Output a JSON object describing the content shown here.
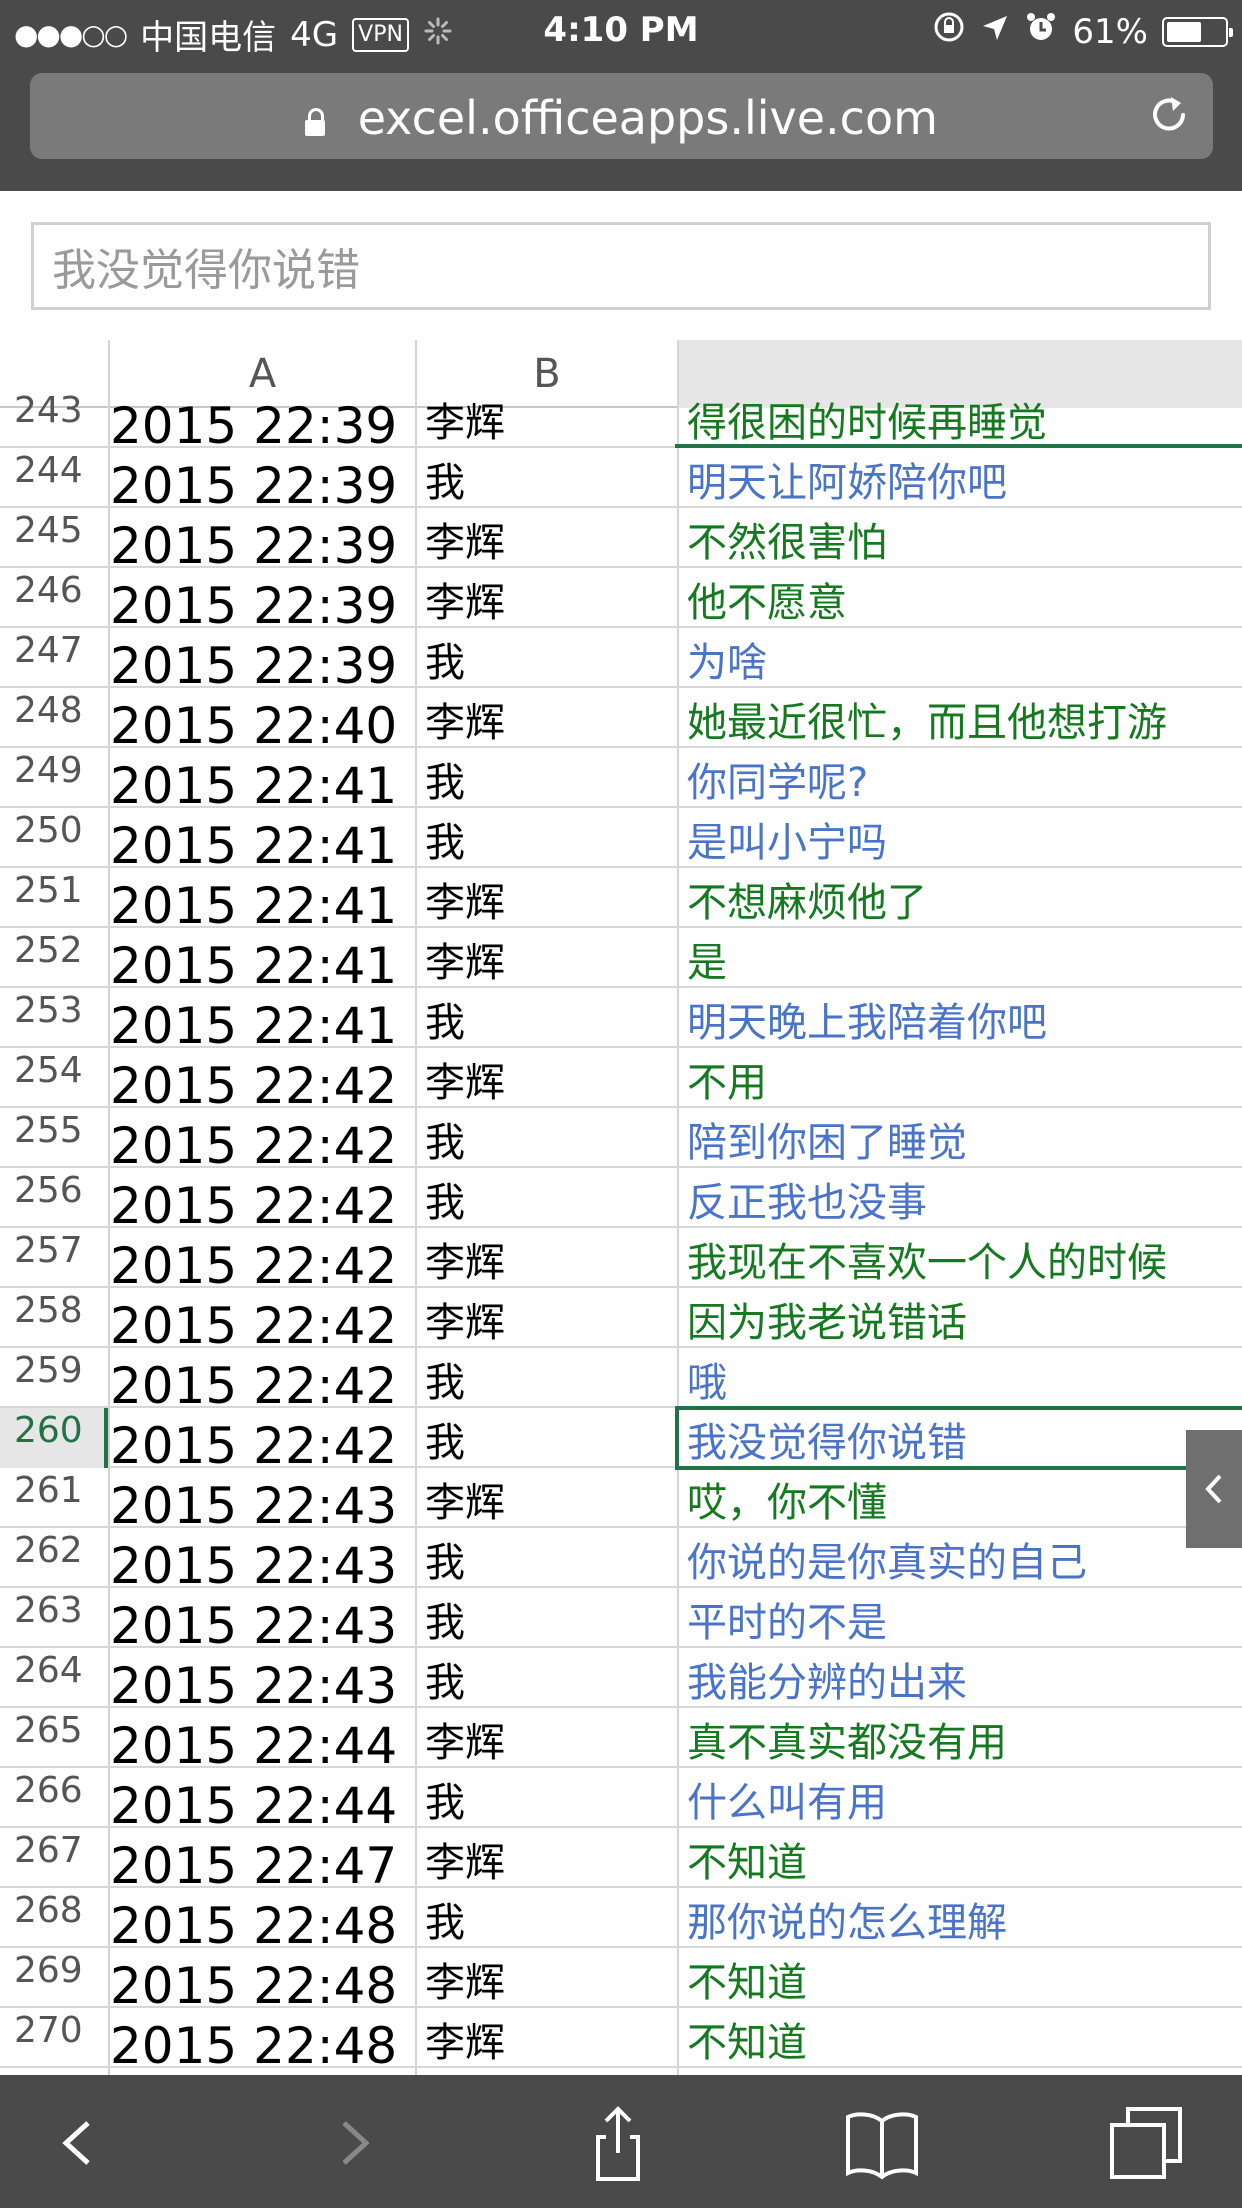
{
  "status_bar": {
    "signal": "●●●○○",
    "carrier": "中国电信",
    "network": "4G",
    "vpn": "VPN",
    "time": "4:10 PM",
    "battery_percent": "61%",
    "battery_level": 0.61
  },
  "browser": {
    "url": "excel.officeapps.live.com"
  },
  "formula_bar": {
    "value": "我没觉得你说错"
  },
  "sheet": {
    "columns": [
      "A",
      "B",
      ""
    ],
    "active_row": "260",
    "rows": [
      {
        "num": "243",
        "a": "2015 22:39",
        "b": "李辉",
        "c": "得很困的时候再睡觉",
        "who": "other"
      },
      {
        "num": "244",
        "a": "2015 22:39",
        "b": "我",
        "c": "明天让阿娇陪你吧",
        "who": "me"
      },
      {
        "num": "245",
        "a": "2015 22:39",
        "b": "李辉",
        "c": "不然很害怕",
        "who": "other"
      },
      {
        "num": "246",
        "a": "2015 22:39",
        "b": "李辉",
        "c": "他不愿意",
        "who": "other"
      },
      {
        "num": "247",
        "a": "2015 22:39",
        "b": "我",
        "c": "为啥",
        "who": "me"
      },
      {
        "num": "248",
        "a": "2015 22:40",
        "b": "李辉",
        "c": "她最近很忙，而且他想打游",
        "who": "other"
      },
      {
        "num": "249",
        "a": "2015 22:41",
        "b": "我",
        "c": "你同学呢?",
        "who": "me"
      },
      {
        "num": "250",
        "a": "2015 22:41",
        "b": "我",
        "c": "是叫小宁吗",
        "who": "me"
      },
      {
        "num": "251",
        "a": "2015 22:41",
        "b": "李辉",
        "c": "不想麻烦他了",
        "who": "other"
      },
      {
        "num": "252",
        "a": "2015 22:41",
        "b": "李辉",
        "c": "是",
        "who": "other"
      },
      {
        "num": "253",
        "a": "2015 22:41",
        "b": "我",
        "c": "明天晚上我陪着你吧",
        "who": "me"
      },
      {
        "num": "254",
        "a": "2015 22:42",
        "b": "李辉",
        "c": "不用",
        "who": "other"
      },
      {
        "num": "255",
        "a": "2015 22:42",
        "b": "我",
        "c": "陪到你困了睡觉",
        "who": "me"
      },
      {
        "num": "256",
        "a": "2015 22:42",
        "b": "我",
        "c": "反正我也没事",
        "who": "me"
      },
      {
        "num": "257",
        "a": "2015 22:42",
        "b": "李辉",
        "c": "我现在不喜欢一个人的时候",
        "who": "other"
      },
      {
        "num": "258",
        "a": "2015 22:42",
        "b": "李辉",
        "c": "因为我老说错话",
        "who": "other"
      },
      {
        "num": "259",
        "a": "2015 22:42",
        "b": "我",
        "c": "哦",
        "who": "me"
      },
      {
        "num": "260",
        "a": "2015 22:42",
        "b": "我",
        "c": "我没觉得你说错",
        "who": "me"
      },
      {
        "num": "261",
        "a": "2015 22:43",
        "b": "李辉",
        "c": "哎，你不懂",
        "who": "other"
      },
      {
        "num": "262",
        "a": "2015 22:43",
        "b": "我",
        "c": "你说的是你真实的自己",
        "who": "me"
      },
      {
        "num": "263",
        "a": "2015 22:43",
        "b": "我",
        "c": "平时的不是",
        "who": "me"
      },
      {
        "num": "264",
        "a": "2015 22:43",
        "b": "我",
        "c": "我能分辨的出来",
        "who": "me"
      },
      {
        "num": "265",
        "a": "2015 22:44",
        "b": "李辉",
        "c": "真不真实都没有用",
        "who": "other"
      },
      {
        "num": "266",
        "a": "2015 22:44",
        "b": "我",
        "c": "什么叫有用",
        "who": "me"
      },
      {
        "num": "267",
        "a": "2015 22:47",
        "b": "李辉",
        "c": "不知道",
        "who": "other"
      },
      {
        "num": "268",
        "a": "2015 22:48",
        "b": "我",
        "c": "那你说的怎么理解",
        "who": "me"
      },
      {
        "num": "269",
        "a": "2015 22:48",
        "b": "李辉",
        "c": "不知道",
        "who": "other"
      },
      {
        "num": "270",
        "a": "2015 22:48",
        "b": "李辉",
        "c": "不知道",
        "who": "other"
      }
    ]
  },
  "colors": {
    "chrome": "#4a4a4a",
    "me_text": "#4a74c9",
    "other_text": "#157a1f",
    "selection": "#217346"
  },
  "toolbar": {
    "icons": [
      "back-icon",
      "forward-icon",
      "share-icon",
      "bookmarks-icon",
      "tabs-icon"
    ]
  }
}
